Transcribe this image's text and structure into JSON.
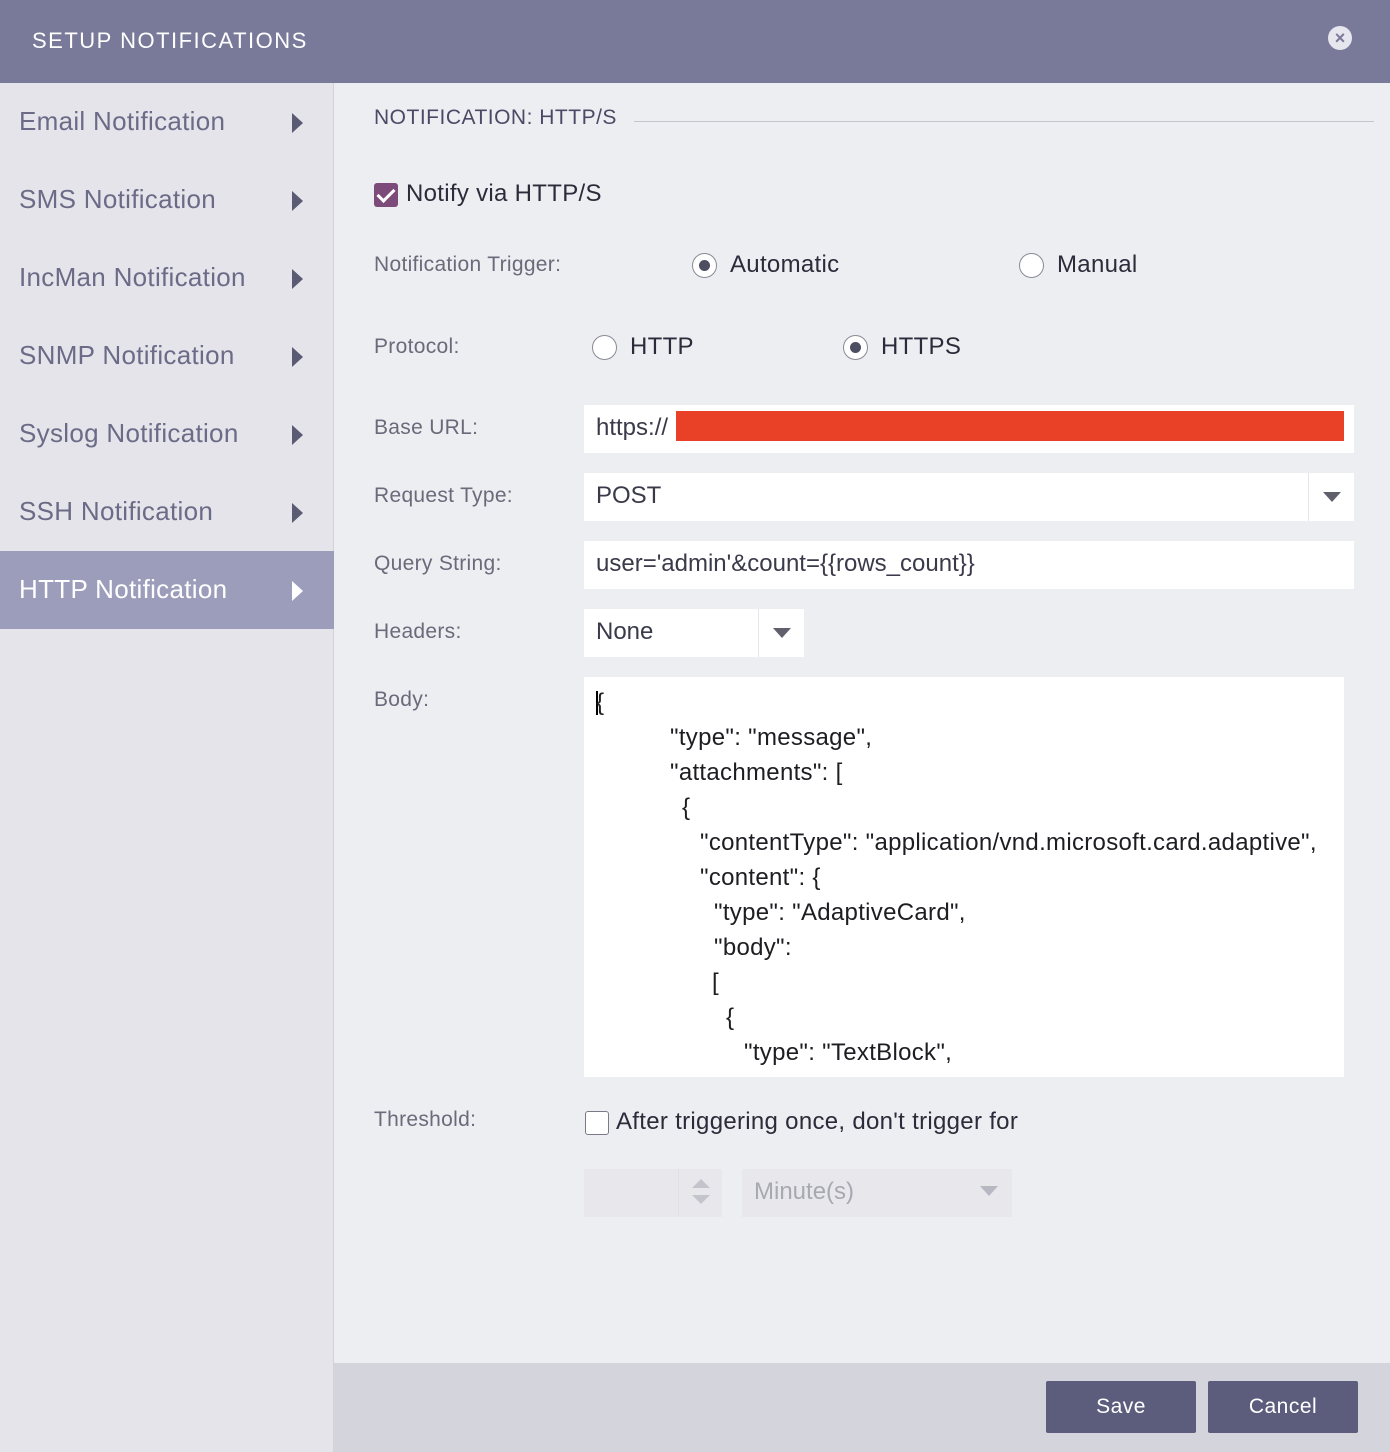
{
  "dialog": {
    "title": "SETUP NOTIFICATIONS",
    "close_icon": "close-icon"
  },
  "sidebar": {
    "items": [
      {
        "label": "Email Notification",
        "active": false
      },
      {
        "label": "SMS Notification",
        "active": false
      },
      {
        "label": "IncMan Notification",
        "active": false
      },
      {
        "label": "SNMP Notification",
        "active": false
      },
      {
        "label": "Syslog Notification",
        "active": false
      },
      {
        "label": "SSH Notification",
        "active": false
      },
      {
        "label": "HTTP Notification",
        "active": true
      }
    ]
  },
  "main": {
    "section_title": "NOTIFICATION: HTTP/S",
    "notify": {
      "label": "Notify via HTTP/S",
      "checked": true
    },
    "trigger": {
      "label": "Notification Trigger:",
      "options": [
        {
          "label": "Automatic",
          "selected": true
        },
        {
          "label": "Manual",
          "selected": false
        }
      ]
    },
    "protocol": {
      "label": "Protocol:",
      "options": [
        {
          "label": "HTTP",
          "selected": false
        },
        {
          "label": "HTTPS",
          "selected": true
        }
      ]
    },
    "base_url": {
      "label": "Base URL:",
      "value": "https://"
    },
    "request_type": {
      "label": "Request Type:",
      "value": "POST"
    },
    "query_string": {
      "label": "Query String:",
      "value": "user='admin'&count={{rows_count}}"
    },
    "headers": {
      "label": "Headers:",
      "value": "None"
    },
    "body": {
      "label": "Body:",
      "lines": [
        "{",
        "\"type\": \"message\",",
        "\"attachments\": [",
        "{",
        "\"contentType\": \"application/vnd.microsoft.card.adaptive\",",
        "\"content\": {",
        "\"type\": \"AdaptiveCard\",",
        "\"body\":",
        "[",
        "{",
        "\"type\": \"TextBlock\","
      ]
    },
    "threshold": {
      "label": "Threshold:",
      "checkbox_label": "After triggering once, don't trigger for",
      "checked": false,
      "amount": "",
      "unit": "Minute(s)"
    }
  },
  "footer": {
    "save_label": "Save",
    "cancel_label": "Cancel"
  },
  "colors": {
    "header": "#797a9a",
    "sidebar_active": "#9c9dbb",
    "checkbox": "#7d4b79",
    "button": "#5c5d7c",
    "redaction": "#e84128"
  }
}
